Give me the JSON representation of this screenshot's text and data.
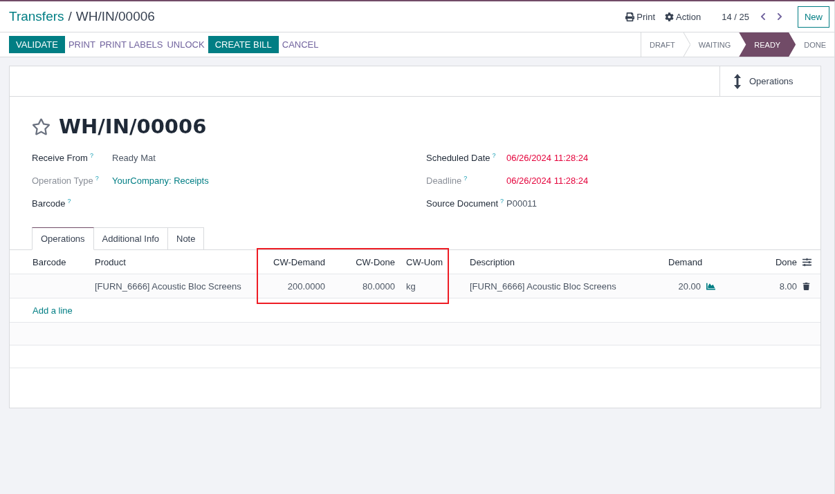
{
  "breadcrumb": [
    {
      "label": "Transfers",
      "kind": "link"
    },
    {
      "label": "/",
      "kind": "separator"
    },
    {
      "label": "WH/IN/00006",
      "kind": "current"
    }
  ],
  "header_actions": [
    {
      "label": "Print",
      "kind": "print"
    },
    {
      "label": "Action",
      "kind": "action"
    }
  ],
  "pager": "14 / 25",
  "new_button": "New",
  "buttons": [
    {
      "label": "VALIDATE",
      "kind": "primary"
    },
    {
      "label": "PRINT",
      "kind": "link"
    },
    {
      "label": "PRINT LABELS",
      "kind": "link"
    },
    {
      "label": "UNLOCK",
      "kind": "link"
    },
    {
      "label": "CREATE BILL",
      "kind": "primary"
    },
    {
      "label": "CANCEL",
      "kind": "link"
    }
  ],
  "stages": [
    {
      "label": "DRAFT",
      "selected": false
    },
    {
      "label": "WAITING",
      "selected": false
    },
    {
      "label": "READY",
      "selected": true
    },
    {
      "label": "DONE",
      "selected": false
    }
  ],
  "smart_button": "Operations",
  "record": {
    "title": "WH/IN/00006",
    "starred": false
  },
  "fields_left": [
    {
      "label": "Receive From",
      "muted": false,
      "value": "Ready Mat",
      "kind": "text",
      "overdue": false
    },
    {
      "label": "Operation Type",
      "muted": true,
      "value": "YourCompany: Receipts",
      "kind": "link",
      "overdue": false
    },
    {
      "label": "Barcode",
      "muted": false
    }
  ],
  "fields_right": [
    {
      "label": "Scheduled Date",
      "muted": false,
      "value": "06/26/2024 11:28:24",
      "kind": "text",
      "overdue": true
    },
    {
      "label": "Deadline",
      "muted": true,
      "value": "06/26/2024 11:28:24",
      "kind": "text",
      "overdue": true
    },
    {
      "label": "Source Document",
      "muted": false,
      "value": "P00011",
      "kind": "text",
      "overdue": false
    }
  ],
  "help_mark": "?",
  "tabs": [
    {
      "label": "Operations",
      "selected": true
    },
    {
      "label": "Additional Info",
      "selected": false
    },
    {
      "label": "Note",
      "selected": false
    }
  ],
  "table": {
    "columns": [
      {
        "label": "Barcode",
        "kind": "text"
      },
      {
        "label": "Product",
        "kind": "text"
      },
      {
        "label": "CW-Demand",
        "kind": "number"
      },
      {
        "label": "CW-Done",
        "kind": "number"
      },
      {
        "label": "CW-Uom",
        "kind": "text"
      },
      {
        "label": "Description",
        "kind": "text"
      },
      {
        "label": "Demand",
        "kind": "number"
      },
      {
        "label": "Done",
        "kind": "number"
      }
    ],
    "rows": [
      {
        "product": "[FURN_6666] Acoustic Bloc Screens",
        "cw_demand": "200.0000",
        "cw_done": "80.0000",
        "cw_uom": "kg",
        "description": "[FURN_6666] Acoustic Bloc Screens",
        "demand": "20.00",
        "done": "8.00"
      }
    ],
    "add_line": "Add a line"
  }
}
